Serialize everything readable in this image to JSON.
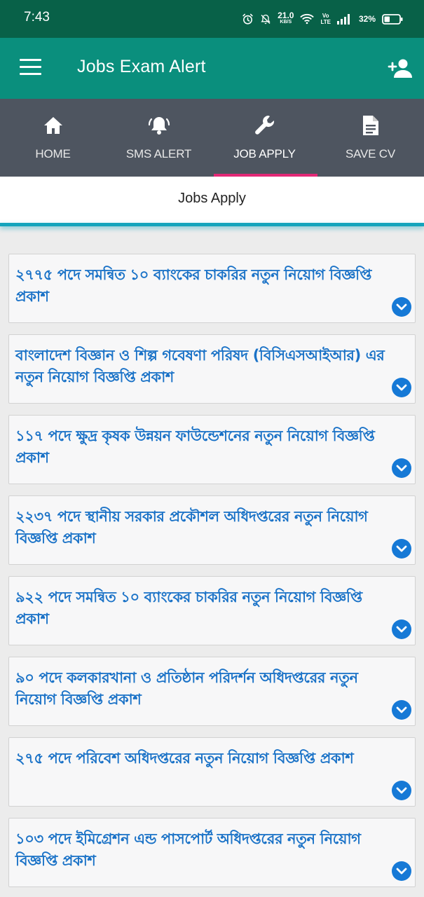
{
  "status_bar": {
    "time": "7:43",
    "net_speed_value": "21.0",
    "net_speed_unit": "KB/S",
    "volte_top": "Vo",
    "volte_bottom": "LTE",
    "battery": "32%"
  },
  "app_bar": {
    "title": "Jobs Exam Alert",
    "menu_icon": "hamburger-menu-icon",
    "action_icon": "add-user-icon"
  },
  "tabs": [
    {
      "label": "HOME",
      "icon": "home-icon",
      "active": false
    },
    {
      "label": "SMS ALERT",
      "icon": "bell-icon",
      "active": false
    },
    {
      "label": "JOB APPLY",
      "icon": "wrench-icon",
      "active": true
    },
    {
      "label": "SAVE CV",
      "icon": "document-icon",
      "active": false
    }
  ],
  "subheader": {
    "title": "Jobs Apply"
  },
  "jobs": [
    {
      "title": "২৭৭৫ পদে সমন্বিত ১০ ব্যাংকের চাকরির নতুন নিয়োগ বিজ্ঞপ্তি প্রকাশ"
    },
    {
      "title": "বাংলাদেশ বিজ্ঞান ও শিল্প গবেষণা পরিষদ (বিসিএসআইআর) এর নতুন নিয়োগ বিজ্ঞপ্তি প্রকাশ"
    },
    {
      "title": "১১৭ পদে ক্ষুদ্র কৃষক উন্নয়ন ফাউন্ডেশনের নতুন নিয়োগ বিজ্ঞপ্তি প্রকাশ"
    },
    {
      "title": "২২৩৭ পদে স্থানীয় সরকার প্রকৌশল অধিদপ্তরের নতুন নিয়োগ বিজ্ঞপ্তি প্রকাশ"
    },
    {
      "title": "৯২২ পদে সমন্বিত ১০ ব্যাংকের চাকরির নতুন নিয়োগ বিজ্ঞপ্তি প্রকাশ"
    },
    {
      "title": "৯০ পদে কলকারখানা ও প্রতিষ্ঠান পরিদর্শন অধিদপ্তরের নতুন নিয়োগ বিজ্ঞপ্তি প্রকাশ"
    },
    {
      "title": "২৭৫ পদে পরিবেশ অধিদপ্তরের নতুন নিয়োগ বিজ্ঞপ্তি প্রকাশ"
    },
    {
      "title": "১০৩ পদে ইমিগ্রেশন এন্ড পাসপোর্ট অধিদপ্তরের নতুন নিয়োগ বিজ্ঞপ্তি প্রকাশ"
    }
  ],
  "colors": {
    "status_bar": "#086148",
    "app_bar": "#0a8f7d",
    "tab_bar": "#4e5560",
    "tab_indicator": "#e22876",
    "accent_line": "#14a4bc",
    "job_title": "#1a72c7",
    "expand_button": "#1679d6"
  }
}
